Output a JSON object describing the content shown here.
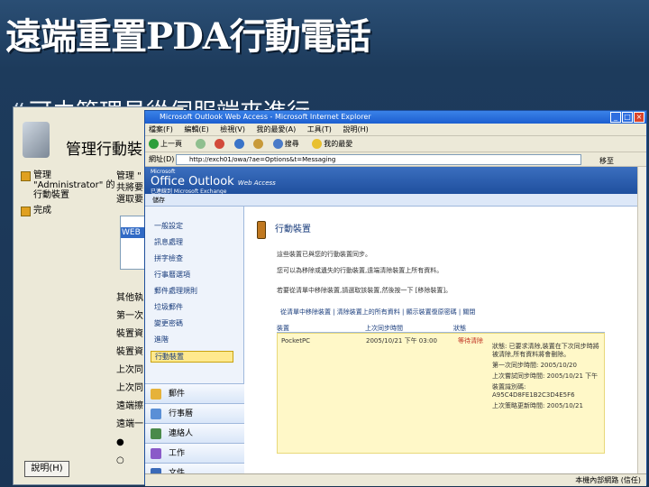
{
  "slide": {
    "title": "遠端重置PDA行動電話",
    "bullet_mark": "❝",
    "bullet_text": "可由管理員從伺服端來進行"
  },
  "back_window": {
    "title": "管理行動裝",
    "list": [
      "管理 \"Administrator\" 的行動裝置",
      "完成"
    ],
    "right_text": [
      "管理 \"",
      "共將要",
      "選取要"
    ],
    "selected_item": "WEB",
    "labels": [
      "其他執",
      "第一次",
      "裝置資",
      "裝置資",
      "上次同",
      "上次同",
      "遠端擦",
      "遠端一",
      "●",
      "○"
    ],
    "help_button": "說明(H)"
  },
  "ie": {
    "title": "Microsoft Outlook Web Access - Microsoft Internet Explorer",
    "menu": [
      "檔案(F)",
      "編輯(E)",
      "檢視(V)",
      "我的最愛(A)",
      "工具(T)",
      "說明(H)"
    ],
    "toolbar": [
      "上一頁",
      "搜尋",
      "我的最愛"
    ],
    "address_label": "網址(D)",
    "address_value": "http://exch01/owa/?ae=Options&t=Messaging",
    "go_label": "移至",
    "status_zone": "本機內部網路 (信任)"
  },
  "owa": {
    "brand_small": "Microsoft",
    "brand": "Office Outlook",
    "brand_sub": "Web Access",
    "user_line": "已連線到 Microsoft Exchange",
    "toolbar_label": "儲存",
    "nav_items": [
      "一般設定",
      "訊息處理",
      "拼字檢查",
      "行事曆選項",
      "郵件處理規則",
      "垃圾郵件",
      "變更密碼",
      "進階",
      "行動裝置"
    ],
    "nav_bottom": [
      "郵件",
      "行事曆",
      "連絡人",
      "工作",
      "文件"
    ],
    "content": {
      "title": "行動裝置",
      "lines": [
        "這些裝置已與您的行動裝置同步。",
        "您可以為移除或遺失的行動裝置,遠端清除裝置上所有資料。",
        "若要從清單中移除裝置,請選取該裝置,然後按一下 [移除裝置]。"
      ],
      "links": "從清單中移除裝置 | 清除裝置上的所有資料 | 顯示裝置復原密碼 | 關閉",
      "table_headers": [
        "裝置",
        "上次同步時間",
        "狀態"
      ],
      "row": {
        "device": "PocketPC",
        "last_sync": "2005/10/21 下午 03:00",
        "status": "等待清除"
      },
      "details": [
        "狀態: 已要求清除,裝置在下次同步時將被清除,所有資料將會刪除。",
        "第一次同步時間: 2005/10/20",
        "上次嘗試同步時間: 2005/10/21 下午",
        "裝置識別碼: A95C4D8FE1B2C3D4E5F6",
        "上次策略更新時間: 2005/10/21"
      ]
    }
  }
}
